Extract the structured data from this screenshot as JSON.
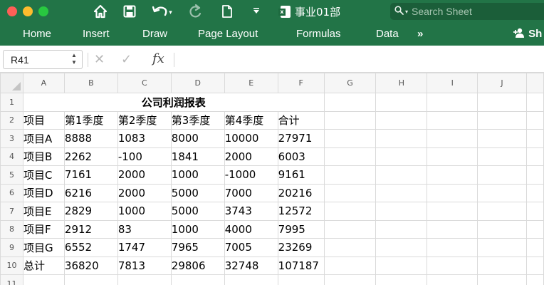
{
  "window": {
    "document_title": "事业01部"
  },
  "quick_access": [
    "home-icon",
    "save-icon",
    "undo-icon",
    "redo-icon",
    "new-document-icon",
    "customize-dropdown-icon"
  ],
  "search": {
    "placeholder": "Search Sheet"
  },
  "ribbon": {
    "tabs": [
      "Home",
      "Insert",
      "Draw",
      "Page Layout",
      "Formulas",
      "Data"
    ],
    "overflow": "»",
    "share_label": "Sh"
  },
  "formula_bar": {
    "name_box": "R41",
    "fx_label": "fx",
    "formula": ""
  },
  "columns": [
    "A",
    "B",
    "C",
    "D",
    "E",
    "F",
    "G",
    "H",
    "I",
    "J"
  ],
  "rows": [
    {
      "num": "1",
      "title": "公司利润报表"
    },
    {
      "num": "2",
      "cells": [
        "项目",
        "第1季度",
        "第2季度",
        "第3季度",
        "第4季度",
        "合计"
      ]
    },
    {
      "num": "3",
      "cells": [
        "项目A",
        "8888",
        "1083",
        "8000",
        "10000",
        "27971"
      ]
    },
    {
      "num": "4",
      "cells": [
        "项目B",
        "2262",
        "-100",
        "1841",
        "2000",
        "6003"
      ]
    },
    {
      "num": "5",
      "cells": [
        "项目C",
        "7161",
        "2000",
        "1000",
        "-1000",
        "9161"
      ]
    },
    {
      "num": "6",
      "cells": [
        "项目D",
        "6216",
        "2000",
        "5000",
        "7000",
        "20216"
      ]
    },
    {
      "num": "7",
      "cells": [
        "项目E",
        "2829",
        "1000",
        "5000",
        "3743",
        "12572"
      ]
    },
    {
      "num": "8",
      "cells": [
        "项目F",
        "2912",
        "83",
        "1000",
        "4000",
        "7995"
      ]
    },
    {
      "num": "9",
      "cells": [
        "项目G",
        "6552",
        "1747",
        "7965",
        "7005",
        "23269"
      ]
    },
    {
      "num": "10",
      "cells": [
        "总计",
        "36820",
        "7813",
        "29806",
        "32748",
        "107187"
      ]
    },
    {
      "num": "11",
      "cells": []
    }
  ]
}
